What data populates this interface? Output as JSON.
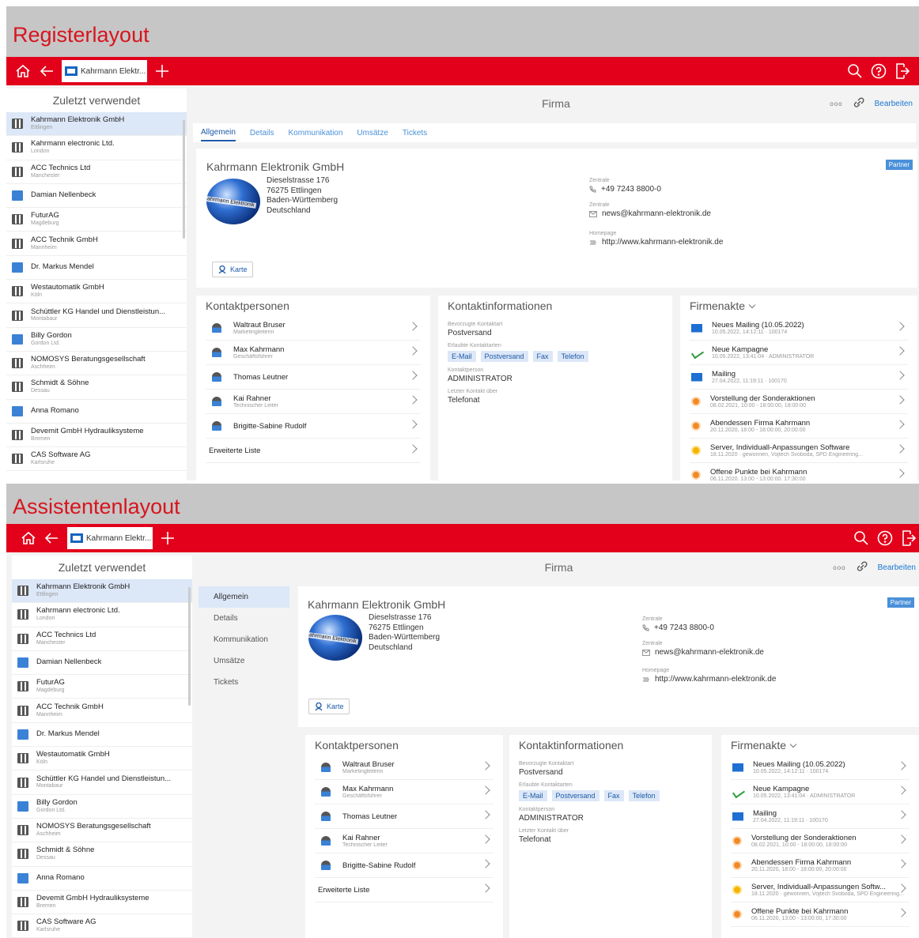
{
  "captions": {
    "register": "Registerlayout",
    "assistent": "Assistentenlayout"
  },
  "toolbar": {
    "tab_label": "Kahrmann Elektr...",
    "icons": [
      "home-icon",
      "back-arrow-icon",
      "plus-icon",
      "search-icon",
      "help-icon",
      "logout-icon"
    ]
  },
  "sidebar": {
    "title": "Zuletzt verwendet",
    "items": [
      {
        "name": "Kahrmann Elektronik GmbH",
        "sub": "Ettlingen",
        "type": "company"
      },
      {
        "name": "Kahrmann electronic Ltd.",
        "sub": "London",
        "type": "company"
      },
      {
        "name": "ACC Technics Ltd",
        "sub": "Manchester",
        "type": "company"
      },
      {
        "name": "Damian Nellenbeck",
        "sub": "",
        "type": "person"
      },
      {
        "name": "FuturAG",
        "sub": "Magdeburg",
        "type": "company"
      },
      {
        "name": "ACC Technik GmbH",
        "sub": "Mannheim",
        "type": "company"
      },
      {
        "name": "Dr. Markus Mendel",
        "sub": "",
        "type": "person"
      },
      {
        "name": "Westautomatik GmbH",
        "sub": "Köln",
        "type": "company"
      },
      {
        "name": "Schüttler KG Handel und Dienstleistun...",
        "sub": "Montabaur",
        "type": "company"
      },
      {
        "name": "Billy Gordon",
        "sub": "Gordon Ltd.",
        "type": "person"
      },
      {
        "name": "NOMOSYS Beratungsgesellschaft",
        "sub": "Aschheim",
        "type": "company"
      },
      {
        "name": "Schmidt & Söhne",
        "sub": "Dessau",
        "type": "company"
      },
      {
        "name": "Anna Romano",
        "sub": "",
        "type": "person"
      },
      {
        "name": "Devemit GmbH Hydrauliksysteme",
        "sub": "Bremen",
        "type": "company"
      },
      {
        "name": "CAS Software AG",
        "sub": "Karlsruhe",
        "type": "company"
      }
    ]
  },
  "header": {
    "title": "Firma",
    "edit": "Bearbeiten",
    "more": "ooo"
  },
  "tabs": [
    "Allgemein",
    "Details",
    "Kommunikation",
    "Umsätze",
    "Tickets"
  ],
  "company": {
    "name": "Kahrmann Elektronik GmbH",
    "logo_text": "Kahrmann Elektronik",
    "address": [
      "Dieselstrasse 176",
      "76275 Ettlingen",
      "Baden-Württemberg",
      "Deutschland"
    ],
    "phone_label": "Zentrale",
    "phone": "+49 7243 8800-0",
    "email_label": "Zentrale",
    "email": "news@kahrmann-elektronik.de",
    "web_label": "Homepage",
    "web": "http://www.kahrmann-elektronik.de",
    "badge": "Partner",
    "map_button": "Karte"
  },
  "contacts": {
    "title": "Kontaktpersonen",
    "items": [
      {
        "name": "Waltraut Bruser",
        "role": "Marketingleiterin"
      },
      {
        "name": "Max Kahrmann",
        "role": "Geschäftsführer"
      },
      {
        "name": "Thomas Leutner",
        "role": ""
      },
      {
        "name": "Kai Rahner",
        "role": "Technischer Leiter"
      },
      {
        "name": "Brigitte-Sabine Rudolf",
        "role": ""
      }
    ],
    "more": "Erweiterte Liste"
  },
  "contactinfo": {
    "title": "Kontaktinformationen",
    "pref_label": "Bevorzugte Kontaktart",
    "pref": "Postversand",
    "allowed_label": "Erlaubte Kontaktarten",
    "allowed": [
      "E-Mail",
      "Postversand",
      "Fax",
      "Telefon"
    ],
    "person_label": "Kontaktperson",
    "person": "ADMINISTRATOR",
    "last_label": "Letzter Kontakt über",
    "last": "Telefonat"
  },
  "files": {
    "title": "Firmenakte",
    "items": [
      {
        "type": "mail",
        "title": "Neues Mailing (10.05.2022)",
        "sub": "10.05.2022, 14:12:11 · 100174"
      },
      {
        "type": "campaign",
        "title": "Neue Kampagne",
        "sub": "10.05.2022, 13:41:04 · ADMINISTRATOR"
      },
      {
        "type": "mail",
        "title": "Mailing",
        "sub": "27.04.2022, 11:19:11 · 100170"
      },
      {
        "type": "appointment",
        "title": "Vorstellung der Sonderaktionen",
        "sub": "08.02.2021, 10:00 - 18:00:00, 18:00:00"
      },
      {
        "type": "appointment",
        "title": "Abendessen Firma Kahrmann",
        "sub": "20.11.2020, 18:00 - 18:00:00, 20:00:00"
      },
      {
        "type": "opportunity",
        "title": "Server, Individuall-Anpassungen Software",
        "title_short": "Server, Individuall-Anpassungen Softw...",
        "sub": "18.11.2020 · gewonnen, Vojtech Svoboda, SPD Engineering..."
      },
      {
        "type": "appointment",
        "title": "Offene Punkte bei Kahrmann",
        "sub": "06.11.2020, 13:00 - 13:00:00, 17:30:00"
      }
    ]
  }
}
